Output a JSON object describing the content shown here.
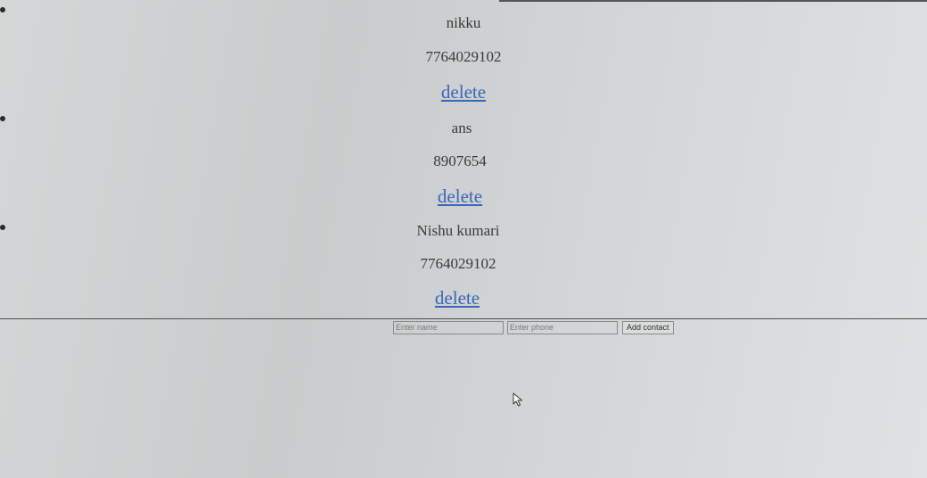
{
  "contacts": [
    {
      "name": "nikku",
      "phone": "7764029102",
      "delete_label": "delete"
    },
    {
      "name": "ans",
      "phone": "8907654",
      "delete_label": "delete"
    },
    {
      "name": "Nishu kumari",
      "phone": "7764029102",
      "delete_label": "delete"
    }
  ],
  "form": {
    "name_placeholder": "Enter name",
    "phone_placeholder": "Enter phone",
    "add_label": "Add contact"
  },
  "icons": {
    "bullet": "bullet-icon",
    "cursor": "mouse-cursor-icon"
  }
}
